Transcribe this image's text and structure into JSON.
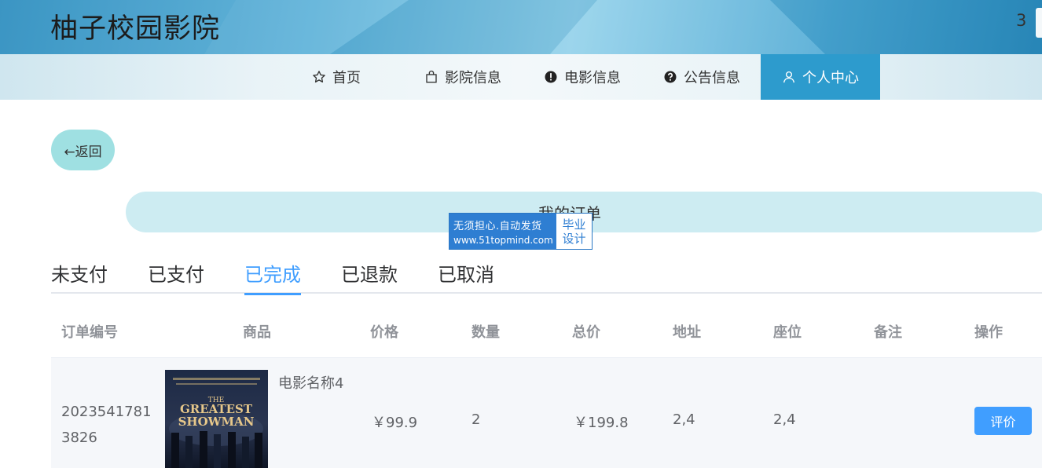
{
  "header": {
    "site_title": "柚子校园影院",
    "corner_text": "3"
  },
  "nav": [
    {
      "label": "首页",
      "icon": "star-icon"
    },
    {
      "label": "影院信息",
      "icon": "shopping-bag-icon"
    },
    {
      "label": "电影信息",
      "icon": "exclamation-circle-icon"
    },
    {
      "label": "公告信息",
      "icon": "question-circle-icon"
    },
    {
      "label": "个人中心",
      "icon": "user-icon",
      "active": true
    }
  ],
  "back_button": "←返回",
  "page_title": "我的订单",
  "watermark": {
    "line1": "无须担心.自动发货",
    "line2": "www.51topmind.com",
    "badge1": "毕业",
    "badge2": "设计"
  },
  "tabs": [
    {
      "label": "未支付"
    },
    {
      "label": "已支付"
    },
    {
      "label": "已完成",
      "active": true
    },
    {
      "label": "已退款"
    },
    {
      "label": "已取消"
    }
  ],
  "table": {
    "columns": [
      "订单编号",
      "商品",
      "价格",
      "数量",
      "总价",
      "地址",
      "座位",
      "备注",
      "操作"
    ],
    "rows": [
      {
        "order_no": "20235417813826",
        "product_name": "电影名称4",
        "poster_text_1": "THE",
        "poster_text_2": "GREATEST",
        "poster_text_3": "SHOWMAN",
        "price": "￥99.9",
        "quantity": "2",
        "total": "￥199.8",
        "address": "2,4",
        "seat": "2,4",
        "remark": "",
        "action": "评价"
      }
    ]
  },
  "colors": {
    "accent": "#409eff",
    "nav_active": "#2d9bcd",
    "back_button": "#9fe0e2",
    "title_pill": "#cdecf2"
  }
}
